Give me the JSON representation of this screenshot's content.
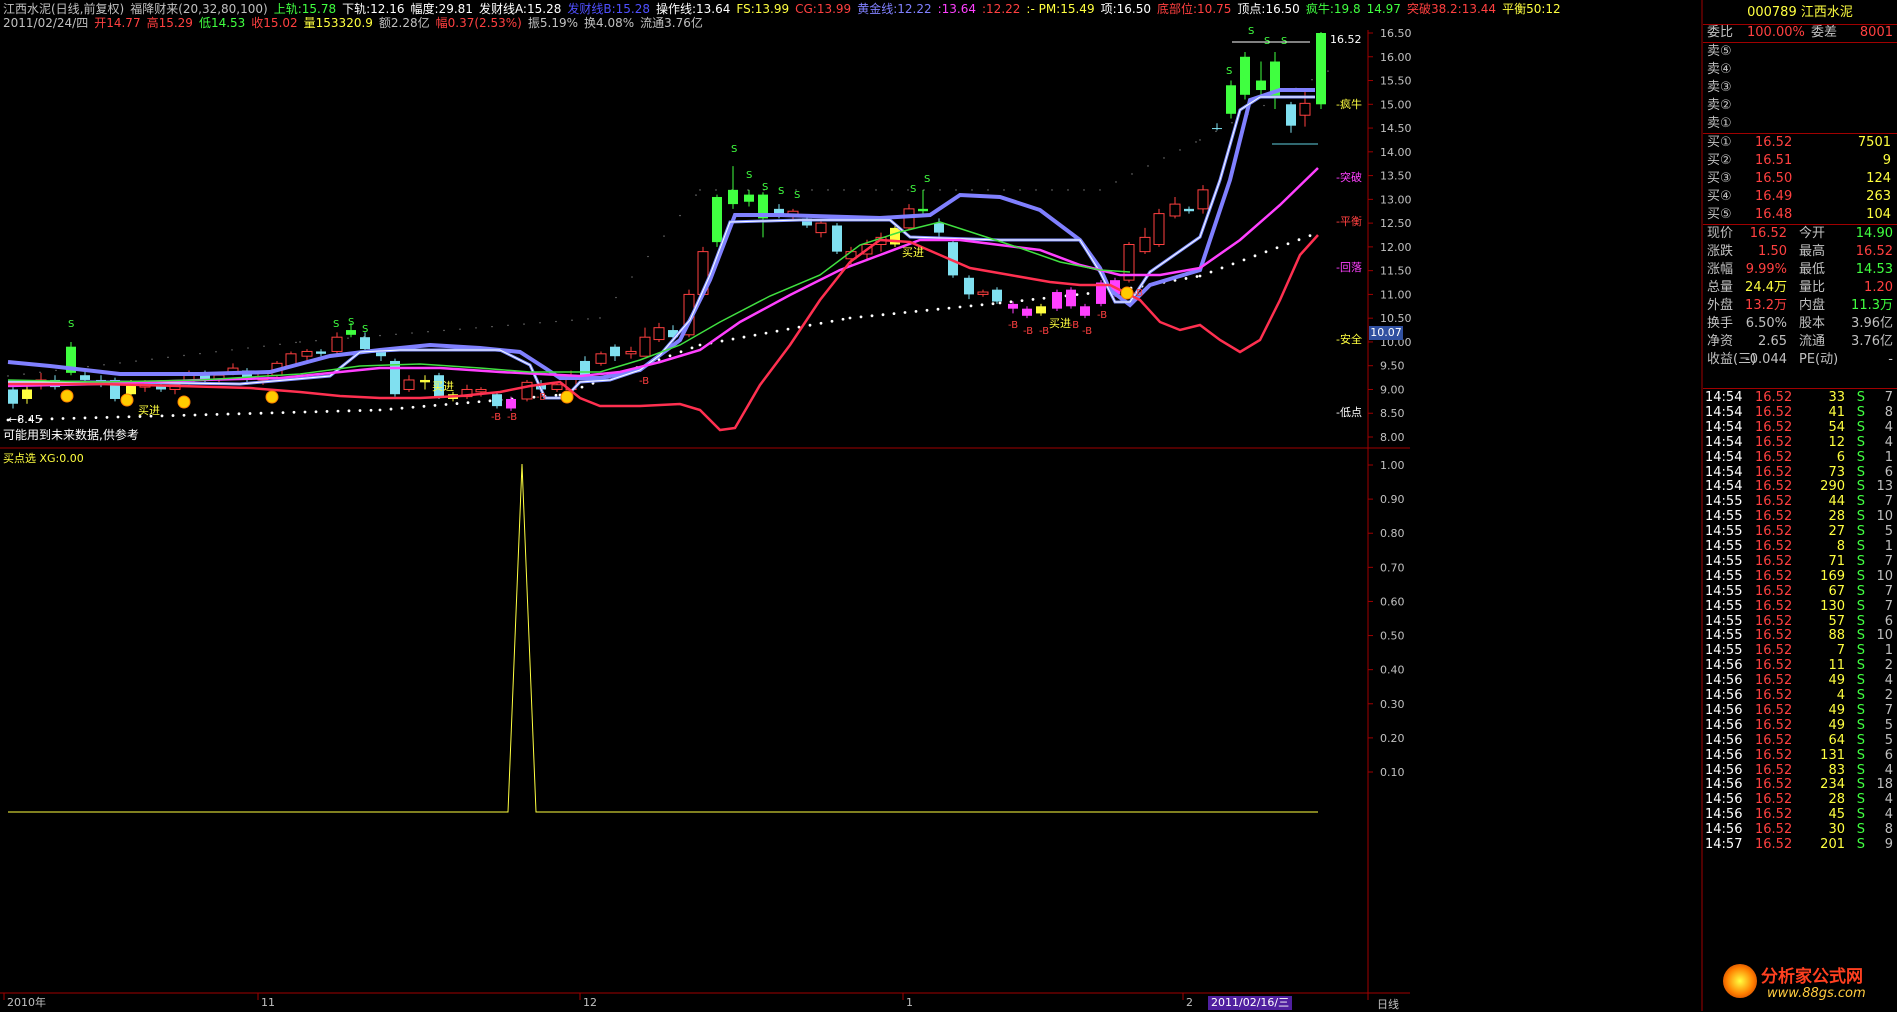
{
  "header_top": {
    "items": [
      {
        "text": "江西水泥(日线,前复权)",
        "color": "#c0c0c0"
      },
      {
        "text": "福降财来(20,32,80,100)",
        "color": "#c0c0c0"
      },
      {
        "text": "上轨:15.78",
        "color": "#40ff40"
      },
      {
        "text": "下轨:12.16",
        "color": "#ffffff"
      },
      {
        "text": "幅度:29.81",
        "color": "#ffffff"
      },
      {
        "text": "发财线A:15.28",
        "color": "#ffffff"
      },
      {
        "text": "发财线B:15.28",
        "color": "#5050ff"
      },
      {
        "text": "操作线:13.64",
        "color": "#ffffff"
      },
      {
        "text": "FS:13.99",
        "color": "#ffff40"
      },
      {
        "text": "CG:13.99",
        "color": "#ff4040"
      },
      {
        "text": "黄金线:12.22",
        "color": "#8080ff"
      },
      {
        "text": ":13.64",
        "color": "#ff40ff"
      },
      {
        "text": ":12.22",
        "color": "#ff4040"
      },
      {
        "text": ":- PM:15.49",
        "color": "#ffff40"
      },
      {
        "text": "项:16.50",
        "color": "#ffffff"
      },
      {
        "text": "底部位:10.75",
        "color": "#ff4040"
      },
      {
        "text": "顶点:16.50",
        "color": "#ffffff"
      },
      {
        "text": "疯牛:19.8",
        "color": "#40ff40"
      },
      {
        "text": "14.97",
        "color": "#40ff40"
      },
      {
        "text": "突破38.2:13.44",
        "color": "#ff4040"
      },
      {
        "text": "平衡50:12",
        "color": "#ffff40"
      }
    ]
  },
  "header_second": {
    "items": [
      {
        "text": "2011/02/24/四",
        "color": "#c0c0c0"
      },
      {
        "text": "开14.77",
        "color": "#ff4040"
      },
      {
        "text": "高15.29",
        "color": "#ff4040"
      },
      {
        "text": "低14.53",
        "color": "#40ff40"
      },
      {
        "text": "收15.02",
        "color": "#ff4040"
      },
      {
        "text": "量153320.9",
        "color": "#ffff40"
      },
      {
        "text": "额2.28亿",
        "color": "#c0c0c0"
      },
      {
        "text": "幅0.37(2.53%)",
        "color": "#ff4040"
      },
      {
        "text": "振5.19%",
        "color": "#c0c0c0"
      },
      {
        "text": "换4.08%",
        "color": "#c0c0c0"
      },
      {
        "text": "流通3.76亿",
        "color": "#c0c0c0"
      }
    ]
  },
  "main_chart": {
    "note_text": "可能用到未来数据,供参考",
    "low_marker": "←8.45",
    "high_marker": "16.52",
    "y_axis_ticks": [
      "16.50",
      "16.00",
      "15.50",
      "15.00",
      "14.50",
      "14.00",
      "13.50",
      "13.00",
      "12.50",
      "12.00",
      "11.50",
      "11.00",
      "10.50",
      "10.00",
      "9.50",
      "9.00",
      "8.50",
      "8.00"
    ],
    "current_price_badge": "10.07",
    "right_labels": [
      {
        "text": "疯牛",
        "color": "#ffff40"
      },
      {
        "text": "突破",
        "color": "#ff40ff"
      },
      {
        "text": "平衡",
        "color": "#ff4040"
      },
      {
        "text": "回落",
        "color": "#ff40ff"
      },
      {
        "text": "安全",
        "color": "#ffff40"
      },
      {
        "text": "低点",
        "color": "#ffffff"
      }
    ],
    "buy_text": "买进",
    "buy_marker_labels": [
      "-B",
      "-B",
      "-B",
      "-B",
      "-B",
      "-B",
      "-B",
      "-B",
      "-B",
      "-B",
      "-B"
    ],
    "s_label": "S"
  },
  "sub_chart": {
    "title": "买点选 XG:0.00",
    "y_axis_ticks": [
      "1.00",
      "0.90",
      "0.80",
      "0.70",
      "0.60",
      "0.50",
      "0.40",
      "0.30",
      "0.20",
      "0.10"
    ]
  },
  "x_axis": {
    "labels": [
      "2010年",
      "11",
      "12",
      "1",
      "2"
    ],
    "date_badge": "2011/02/16/三",
    "period_label": "日线"
  },
  "right_panel": {
    "code": "000789",
    "name": "江西水泥",
    "weibi_label": "委比",
    "weibi_value": "100.00%",
    "weicha_label": "委差",
    "weicha_value": "8001",
    "sell_levels": [
      {
        "label": "卖⑤",
        "price": "",
        "vol": ""
      },
      {
        "label": "卖④",
        "price": "",
        "vol": ""
      },
      {
        "label": "卖③",
        "price": "",
        "vol": ""
      },
      {
        "label": "卖②",
        "price": "",
        "vol": ""
      },
      {
        "label": "卖①",
        "price": "",
        "vol": ""
      }
    ],
    "buy_levels": [
      {
        "label": "买①",
        "price": "16.52",
        "vol": "7501"
      },
      {
        "label": "买②",
        "price": "16.51",
        "vol": "9"
      },
      {
        "label": "买③",
        "price": "16.50",
        "vol": "124"
      },
      {
        "label": "买④",
        "price": "16.49",
        "vol": "263"
      },
      {
        "label": "买⑤",
        "price": "16.48",
        "vol": "104"
      }
    ],
    "stats": [
      {
        "l1": "现价",
        "v1": "16.52",
        "c1": "#ff4040",
        "l2": "今开",
        "v2": "14.90",
        "c2": "#40ff40"
      },
      {
        "l1": "涨跌",
        "v1": "1.50",
        "c1": "#ff4040",
        "l2": "最高",
        "v2": "16.52",
        "c2": "#ff4040"
      },
      {
        "l1": "涨幅",
        "v1": "9.99%",
        "c1": "#ff4040",
        "l2": "最低",
        "v2": "14.53",
        "c2": "#40ff40"
      },
      {
        "l1": "总量",
        "v1": "24.4万",
        "c1": "#ffff40",
        "l2": "量比",
        "v2": "1.20",
        "c2": "#ff4040"
      },
      {
        "l1": "外盘",
        "v1": "13.2万",
        "c1": "#ff4040",
        "l2": "内盘",
        "v2": "11.3万",
        "c2": "#40ff40"
      },
      {
        "l1": "换手",
        "v1": "6.50%",
        "c1": "#c0c0c0",
        "l2": "股本",
        "v2": "3.96亿",
        "c2": "#c0c0c0"
      },
      {
        "l1": "净资",
        "v1": "2.65",
        "c1": "#c0c0c0",
        "l2": "流通",
        "v2": "3.76亿",
        "c2": "#c0c0c0"
      },
      {
        "l1": "收益(三)",
        "v1": "-0.044",
        "c1": "#c0c0c0",
        "l2": "PE(动)",
        "v2": "-",
        "c2": "#c0c0c0"
      }
    ],
    "ticks": [
      {
        "t": "14:54",
        "p": "16.52",
        "v": "33",
        "s": "S",
        "n": "7"
      },
      {
        "t": "14:54",
        "p": "16.52",
        "v": "41",
        "s": "S",
        "n": "8"
      },
      {
        "t": "14:54",
        "p": "16.52",
        "v": "54",
        "s": "S",
        "n": "4"
      },
      {
        "t": "14:54",
        "p": "16.52",
        "v": "12",
        "s": "S",
        "n": "4"
      },
      {
        "t": "14:54",
        "p": "16.52",
        "v": "6",
        "s": "S",
        "n": "1"
      },
      {
        "t": "14:54",
        "p": "16.52",
        "v": "73",
        "s": "S",
        "n": "6"
      },
      {
        "t": "14:54",
        "p": "16.52",
        "v": "290",
        "s": "S",
        "n": "13"
      },
      {
        "t": "14:55",
        "p": "16.52",
        "v": "44",
        "s": "S",
        "n": "7"
      },
      {
        "t": "14:55",
        "p": "16.52",
        "v": "28",
        "s": "S",
        "n": "10"
      },
      {
        "t": "14:55",
        "p": "16.52",
        "v": "27",
        "s": "S",
        "n": "5"
      },
      {
        "t": "14:55",
        "p": "16.52",
        "v": "8",
        "s": "S",
        "n": "1"
      },
      {
        "t": "14:55",
        "p": "16.52",
        "v": "71",
        "s": "S",
        "n": "7"
      },
      {
        "t": "14:55",
        "p": "16.52",
        "v": "169",
        "s": "S",
        "n": "10"
      },
      {
        "t": "14:55",
        "p": "16.52",
        "v": "67",
        "s": "S",
        "n": "7"
      },
      {
        "t": "14:55",
        "p": "16.52",
        "v": "130",
        "s": "S",
        "n": "7"
      },
      {
        "t": "14:55",
        "p": "16.52",
        "v": "57",
        "s": "S",
        "n": "6"
      },
      {
        "t": "14:55",
        "p": "16.52",
        "v": "88",
        "s": "S",
        "n": "10"
      },
      {
        "t": "14:55",
        "p": "16.52",
        "v": "7",
        "s": "S",
        "n": "1"
      },
      {
        "t": "14:56",
        "p": "16.52",
        "v": "11",
        "s": "S",
        "n": "2"
      },
      {
        "t": "14:56",
        "p": "16.52",
        "v": "49",
        "s": "S",
        "n": "4"
      },
      {
        "t": "14:56",
        "p": "16.52",
        "v": "4",
        "s": "S",
        "n": "2"
      },
      {
        "t": "14:56",
        "p": "16.52",
        "v": "49",
        "s": "S",
        "n": "7"
      },
      {
        "t": "14:56",
        "p": "16.52",
        "v": "49",
        "s": "S",
        "n": "5"
      },
      {
        "t": "14:56",
        "p": "16.52",
        "v": "64",
        "s": "S",
        "n": "5"
      },
      {
        "t": "14:56",
        "p": "16.52",
        "v": "131",
        "s": "S",
        "n": "6"
      },
      {
        "t": "14:56",
        "p": "16.52",
        "v": "83",
        "s": "S",
        "n": "4"
      },
      {
        "t": "14:56",
        "p": "16.52",
        "v": "234",
        "s": "S",
        "n": "18"
      },
      {
        "t": "14:56",
        "p": "16.52",
        "v": "28",
        "s": "S",
        "n": "4"
      },
      {
        "t": "14:56",
        "p": "16.52",
        "v": "45",
        "s": "S",
        "n": "4"
      },
      {
        "t": "14:56",
        "p": "16.52",
        "v": "30",
        "s": "S",
        "n": "8"
      },
      {
        "t": "14:57",
        "p": "16.52",
        "v": "201",
        "s": "S",
        "n": "9"
      }
    ],
    "watermark": "分析家公式网",
    "watermark_url": "www.88gs.com"
  },
  "colors": {
    "up": "#ff4040",
    "down_green": "#40ff40",
    "cyan": "#80e0f0",
    "yellow": "#ffff40",
    "magenta": "#ff40ff",
    "blue_line": "#8080ff",
    "border": "#a00000",
    "red_line": "#ff3050"
  }
}
